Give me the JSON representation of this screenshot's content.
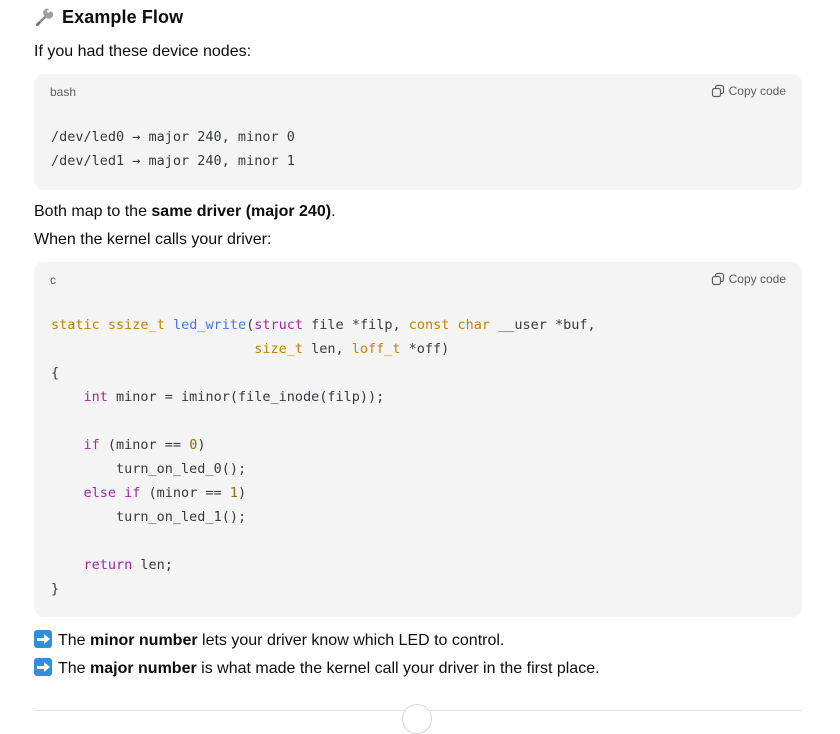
{
  "section": {
    "icon": "wrench-icon",
    "title": "Example Flow"
  },
  "intro": "If you had these device nodes:",
  "code1": {
    "lang": "bash",
    "copy_label": "Copy code",
    "lines": [
      "/dev/led0 → major 240, minor 0",
      "/dev/led1 → major 240, minor 1"
    ]
  },
  "para2": {
    "prefix": "Both map to the ",
    "bold": "same driver (major 240)",
    "suffix": "."
  },
  "para3": "When the kernel calls your driver:",
  "code2": {
    "lang": "c",
    "copy_label": "Copy code",
    "t": {
      "static": "static",
      "ssize_t": "ssize_t",
      "led_write": "led_write",
      "paren_open": "(",
      "struct": "struct",
      "file_filp": " file *filp, ",
      "const": "const",
      "char": "char",
      "user_buf": " __user *buf,",
      "indent2": "                         ",
      "size_t": "size_t",
      "len": " len, ",
      "loff_t": "loff_t",
      "off": " *off)",
      "brace_open": "{",
      "int": "int",
      "minor_decl": " minor = iminor(file_inode(filp));",
      "if": "if",
      "cond0_a": " (minor == ",
      "zero": "0",
      "close": ")",
      "call0": "turn_on_led_0();",
      "else_if": "else if",
      "one": "1",
      "call1": "turn_on_led_1();",
      "return": "return",
      "ret_len": " len;",
      "brace_close": "}"
    }
  },
  "bullets": [
    {
      "icon": "right-arrow-icon",
      "prefix": "The ",
      "bold": "minor number",
      "suffix": " lets your driver know which LED to control."
    },
    {
      "icon": "right-arrow-icon",
      "prefix": "The ",
      "bold": "major number",
      "suffix": " is what made the kernel call your driver in the first place."
    }
  ],
  "colors": {
    "code_bg": "#f4f4f4",
    "keyword": "#a626a4",
    "type": "#c18401",
    "function": "#4078f2",
    "number": "#986801",
    "arrow_badge": "#2f8fdb"
  }
}
